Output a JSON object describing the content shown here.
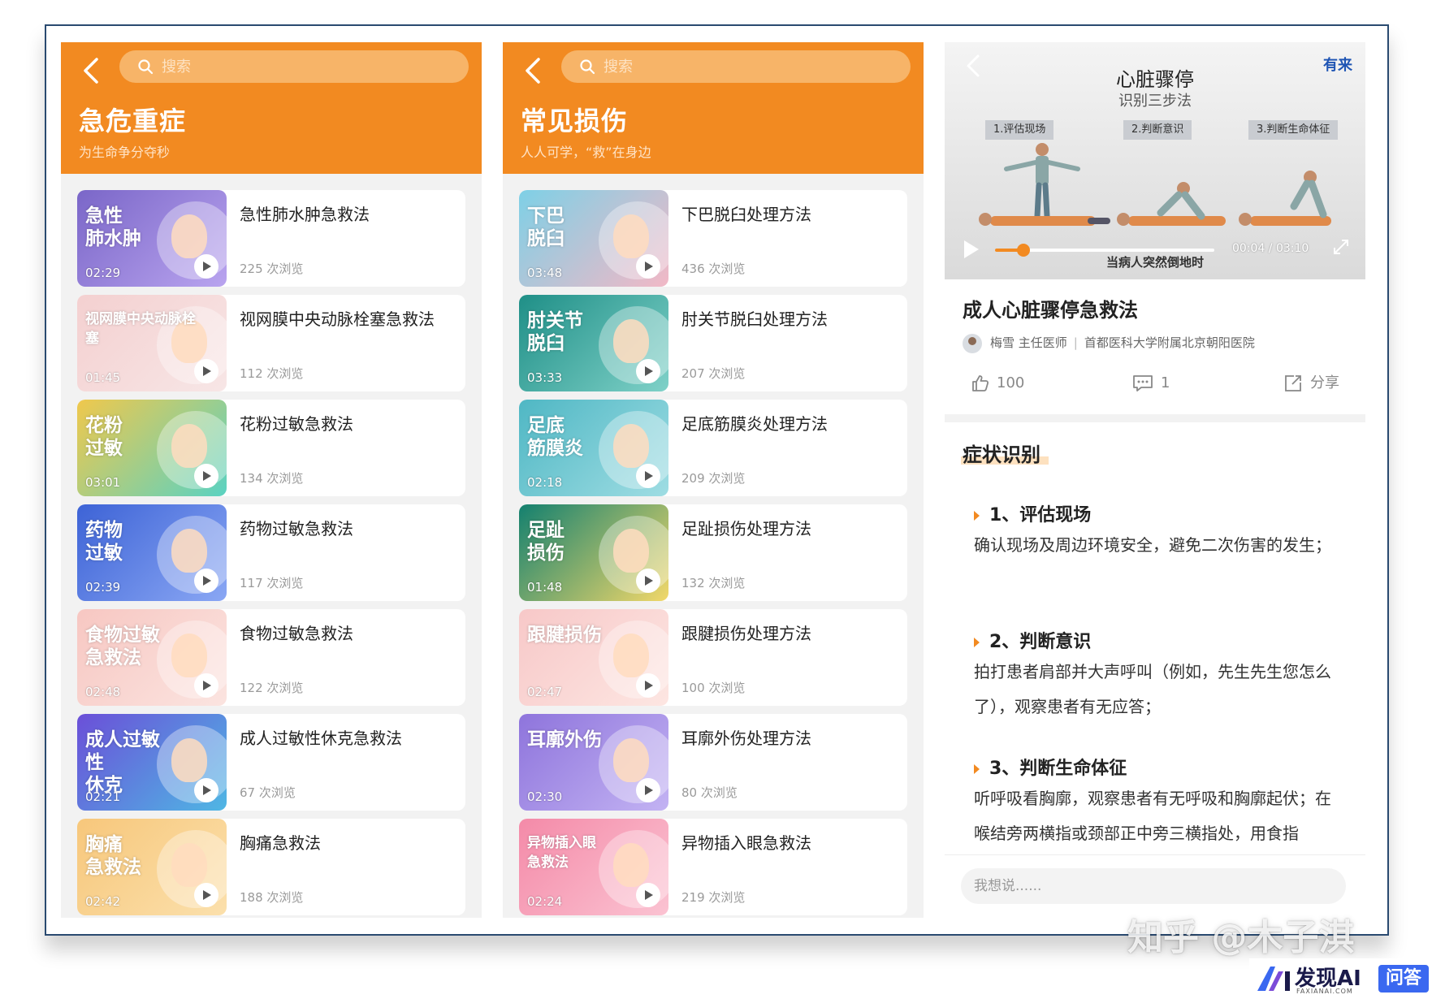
{
  "left_panel": {
    "search_placeholder": "搜索",
    "title": "急危重症",
    "subtitle": "为生命争分夺秒",
    "items": [
      {
        "thumb_label": "急性\n肺水肿",
        "duration": "02:29",
        "title": "急性肺水肿急救法",
        "views": "225 次浏览",
        "bg": "#7a66c8",
        "bg2": "#b9a4ef"
      },
      {
        "thumb_label": "视网膜中央动脉栓塞",
        "duration": "01:45",
        "title": "视网膜中央动脉栓塞急救法",
        "views": "112 次浏览",
        "bg": "#f4d0d0",
        "bg2": "#f7e6e6"
      },
      {
        "thumb_label": "花粉\n过敏",
        "duration": "03:01",
        "title": "花粉过敏急救法",
        "views": "134 次浏览",
        "bg": "#f0c84c",
        "bg2": "#5ad2c2"
      },
      {
        "thumb_label": "药物\n过敏",
        "duration": "02:39",
        "title": "药物过敏急救法",
        "views": "117 次浏览",
        "bg": "#3d63d6",
        "bg2": "#8aa7f4"
      },
      {
        "thumb_label": "食物过敏\n急救法",
        "duration": "02:48",
        "title": "食物过敏急救法",
        "views": "122 次浏览",
        "bg": "#f7c7c2",
        "bg2": "#fbe4e0"
      },
      {
        "thumb_label": "成人过敏性\n休克",
        "duration": "02:21",
        "title": "成人过敏性休克急救法",
        "views": "67 次浏览",
        "bg": "#6b4fd8",
        "bg2": "#4fb7e4"
      },
      {
        "thumb_label": "胸痛\n急救法",
        "duration": "02:42",
        "title": "胸痛急救法",
        "views": "188 次浏览",
        "bg": "#f7c77b",
        "bg2": "#fbe0ac"
      }
    ]
  },
  "mid_panel": {
    "search_placeholder": "搜索",
    "title": "常见损伤",
    "subtitle": "人人可学，“救”在身边",
    "items": [
      {
        "thumb_label": "下巴\n脱臼",
        "duration": "03:48",
        "title": "下巴脱臼处理方法",
        "views": "436 次浏览",
        "bg": "#7ed0e6",
        "bg2": "#f2b8c6"
      },
      {
        "thumb_label": "肘关节\n脱臼",
        "duration": "03:33",
        "title": "肘关节脱臼处理方法",
        "views": "207 次浏览",
        "bg": "#1f8f87",
        "bg2": "#7fd1c8"
      },
      {
        "thumb_label": "足底\n筋膜炎",
        "duration": "02:18",
        "title": "足底筋膜炎处理方法",
        "views": "209 次浏览",
        "bg": "#4fb7c4",
        "bg2": "#9fdde3"
      },
      {
        "thumb_label": "足趾\n损伤",
        "duration": "01:48",
        "title": "足趾损伤处理方法",
        "views": "132 次浏览",
        "bg": "#13806f",
        "bg2": "#f2d86a"
      },
      {
        "thumb_label": "跟腱损伤",
        "duration": "02:47",
        "title": "跟腱损伤处理方法",
        "views": "100 次浏览",
        "bg": "#f7c8c8",
        "bg2": "#fde6e2"
      },
      {
        "thumb_label": "耳廓外伤",
        "duration": "02:30",
        "title": "耳廓外伤处理方法",
        "views": "80 次浏览",
        "bg": "#8e74dc",
        "bg2": "#c3b3f3"
      },
      {
        "thumb_label": "异物插入眼\n急救法",
        "duration": "02:24",
        "title": "异物插入眼急救法",
        "views": "219 次浏览",
        "bg": "#f48aa8",
        "bg2": "#fbc3d2"
      }
    ]
  },
  "detail": {
    "video": {
      "brand": "有来",
      "title": "心脏骤停",
      "subtitle": "识别三步法",
      "steps": [
        "1.评估现场",
        "2.判断意识",
        "3.判断生命体征"
      ],
      "caption": "当病人突然倒地时",
      "time": "00:04 / 03:10",
      "progress": 0.13
    },
    "article_title": "成人心脏骤停急救法",
    "author": "梅雪  主任医师",
    "hospital": "首都医科大学附属北京朝阳医院",
    "likes": "100",
    "comments": "1",
    "share": "分享",
    "section_title": "症状识别",
    "step1_head": "1、评估现场",
    "step1_body": "确认现场及周边环境安全，避免二次伤害的发生；",
    "step2_head": "2、判断意识",
    "step2_body": "拍打患者肩部并大声呼叫（例如，先生先生您怎么了），观察患者有无应答；",
    "step3_head": "3、判断生命体征",
    "step3_body": "听呼吸看胸廓，观察患者有无呼吸和胸廓起伏；在喉结旁两横指或颈部正中旁三横指处，用食指",
    "comment_placeholder": "我想说......"
  },
  "watermark": {
    "zhihu": "知乎 @木子淇",
    "faxian": "发现AI",
    "faxian_small": "FAXIANAI.COM",
    "badge": "问答"
  },
  "colors": {
    "accent": "#f28a21"
  }
}
